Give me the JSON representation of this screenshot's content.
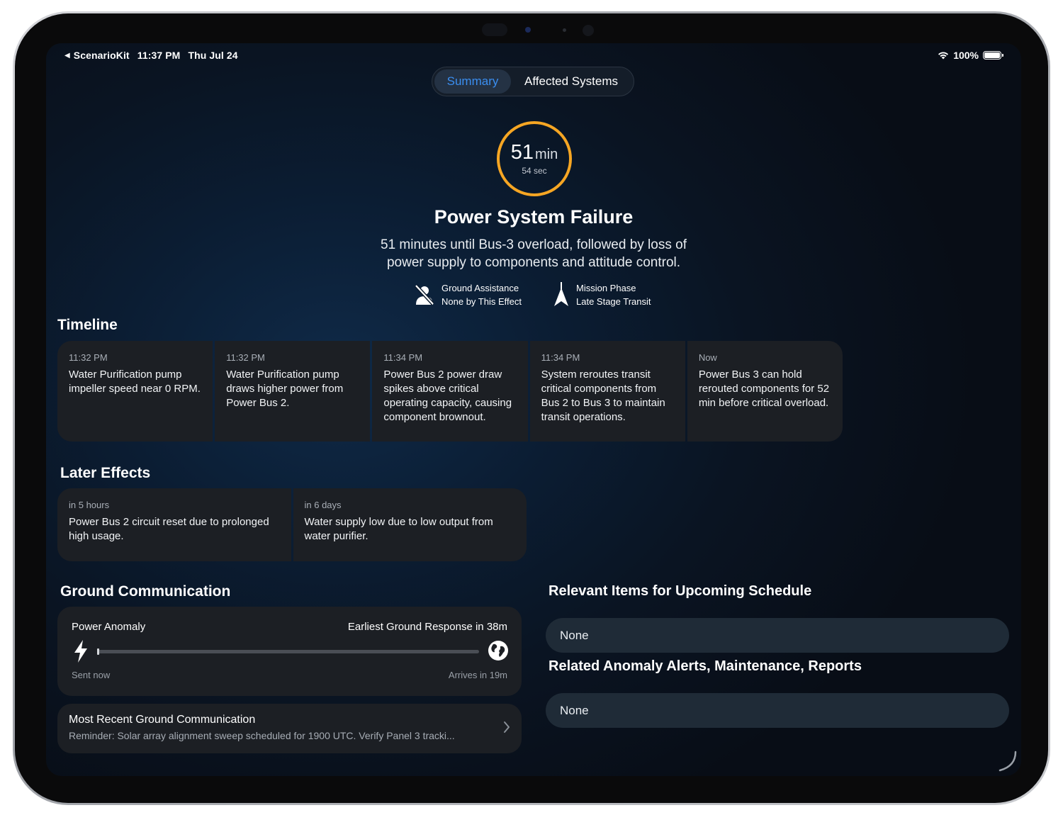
{
  "status_bar": {
    "back_app": "ScenarioKit",
    "time": "11:37 PM",
    "date": "Thu Jul 24",
    "battery": "100%"
  },
  "tabs": [
    {
      "label": "Summary",
      "selected": true
    },
    {
      "label": "Affected Systems",
      "selected": false
    }
  ],
  "countdown": {
    "minutes": "51",
    "minutes_unit": "min",
    "seconds": "54 sec",
    "ring_color": "#f6a623"
  },
  "header": {
    "title": "Power System Failure",
    "description": "51 minutes until Bus-3 overload, followed by loss of power supply to components and attitude control."
  },
  "meta": [
    {
      "icon": "person-slash-icon",
      "label": "Ground Assistance",
      "value": "None by This Effect"
    },
    {
      "icon": "spacecraft-icon",
      "label": "Mission Phase",
      "value": "Late Stage Transit"
    }
  ],
  "timeline": {
    "heading": "Timeline",
    "events": [
      {
        "time": "11:32 PM",
        "text": "Water Purification pump impeller speed near 0 RPM."
      },
      {
        "time": "11:32 PM",
        "text": "Water Purification pump draws higher power from Power Bus 2."
      },
      {
        "time": "11:34 PM",
        "text": "Power Bus 2 power draw spikes above critical operating capacity, causing component brownout."
      },
      {
        "time": "11:34 PM",
        "text": "System reroutes transit critical components from Bus 2 to Bus 3 to maintain transit operations."
      },
      {
        "time": "Now",
        "text": "Power Bus 3 can hold rerouted components for 52 min before critical overload."
      }
    ]
  },
  "later_effects": {
    "heading": "Later Effects",
    "items": [
      {
        "when": "in 5 hours",
        "text": "Power Bus 2 circuit reset due to prolonged high usage."
      },
      {
        "when": "in 6 days",
        "text": "Water supply low due to low output from water purifier."
      }
    ]
  },
  "ground_communication": {
    "heading": "Ground Communication",
    "message": "Power Anomaly",
    "response": "Earliest Ground Response in 38m",
    "sent": "Sent now",
    "arrives": "Arrives in 19m",
    "progress": 0.0
  },
  "recent_comm": {
    "title": "Most Recent Ground Communication",
    "body": "Reminder: Solar array alignment sweep scheduled for 1900 UTC. Verify Panel 3 tracki..."
  },
  "schedule": {
    "heading": "Relevant Items for Upcoming Schedule",
    "value": "None"
  },
  "anomaly": {
    "heading": "Related Anomaly Alerts, Maintenance, Reports",
    "value": "None"
  },
  "colors": {
    "accent": "#3a8ef0",
    "timer": "#f6a623",
    "card": "#1c1f24"
  }
}
